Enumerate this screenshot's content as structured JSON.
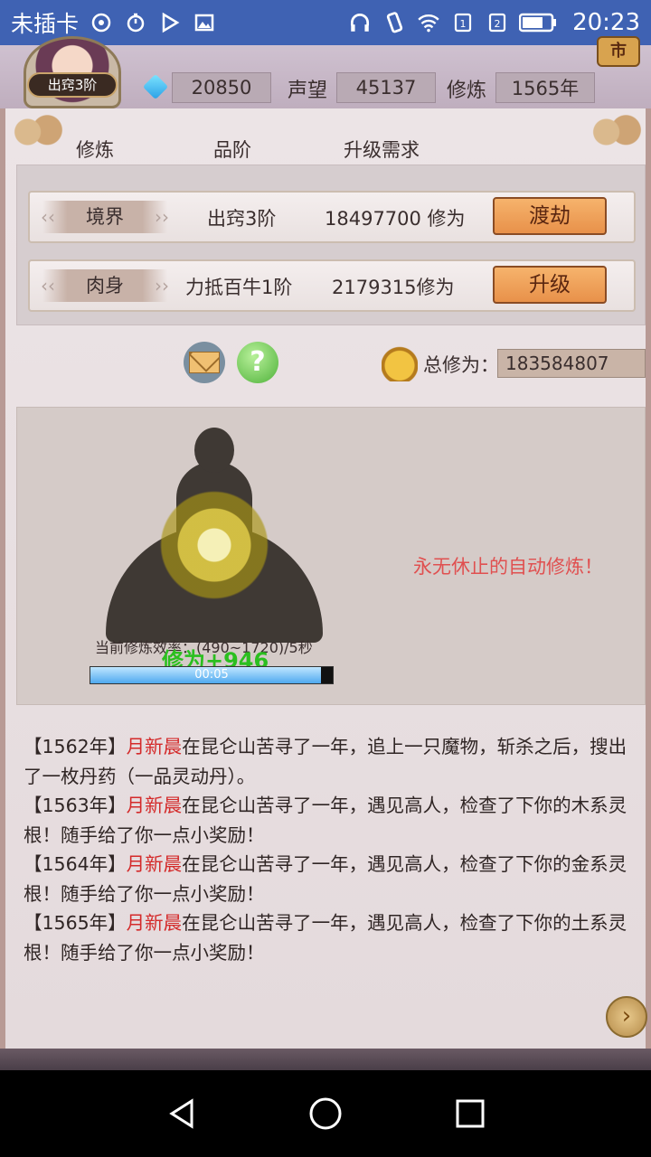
{
  "status_bar": {
    "carrier": "未插卡",
    "time": "20:23"
  },
  "hud": {
    "avatar_badge": "出窍3阶",
    "gems": "20850",
    "fame_label": "声望",
    "fame_value": "45137",
    "cultivation_label": "修炼",
    "cultivation_value": "1565年",
    "shop_label": "市"
  },
  "table_header": {
    "col1": "修炼",
    "col2": "品阶",
    "col3": "升级需求"
  },
  "rows": [
    {
      "tag": "境界",
      "grade": "出窍3阶",
      "requirement": "18497700 修为",
      "action": "渡劫"
    },
    {
      "tag": "肉身",
      "grade": "力抵百牛1阶",
      "requirement": "2179315修为",
      "action": "升级"
    }
  ],
  "total": {
    "label": "总修为：",
    "value": "183584807"
  },
  "cultivation": {
    "efficiency": "当前修炼效率：(490~1720)/5秒",
    "gain": "修为+946",
    "progress_text": "00:05",
    "progress_fraction": 0.95,
    "auto_text": "永无休止的自动修炼！"
  },
  "log": [
    {
      "year": "【1562年】",
      "name": "月新晨",
      "text": "在昆仑山苦寻了一年，追上一只魔物，斩杀之后，搜出了一枚丹药（一品灵动丹）。"
    },
    {
      "year": "【1563年】",
      "name": "月新晨",
      "text": "在昆仑山苦寻了一年，遇见高人，检查了下你的木系灵根！随手给了你一点小奖励！"
    },
    {
      "year": "【1564年】",
      "name": "月新晨",
      "text": "在昆仑山苦寻了一年，遇见高人，检查了下你的金系灵根！随手给了你一点小奖励！"
    },
    {
      "year": "【1565年】",
      "name": "月新晨",
      "text": "在昆仑山苦寻了一年，遇见高人，检查了下你的土系灵根！随手给了你一点小奖励！"
    }
  ],
  "colors": {
    "status_bar": "#3f62b3",
    "name_highlight": "#d42a2a",
    "auto_text": "#e05050",
    "gain_text": "#2bbf1f"
  }
}
